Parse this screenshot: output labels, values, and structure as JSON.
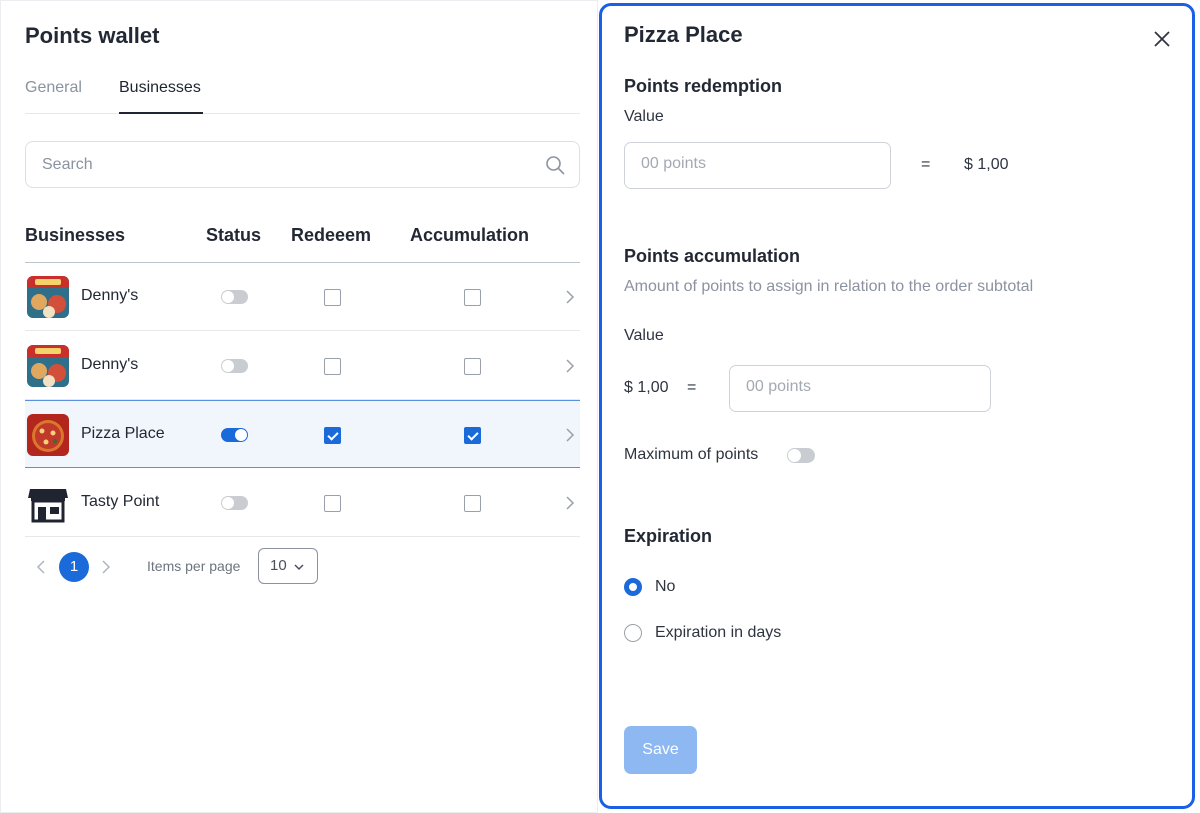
{
  "wallet": {
    "title": "Points wallet",
    "tabs": [
      {
        "label": "General"
      },
      {
        "label": "Businesses"
      }
    ],
    "search": {
      "placeholder": "Search"
    },
    "columns": {
      "business": "Businesses",
      "status": "Status",
      "redeem": "Redeeem",
      "accumulation": "Accumulation"
    },
    "rows": [
      {
        "name": "Denny's",
        "status": false,
        "redeem": false,
        "accumulation": false,
        "thumb": "dennys"
      },
      {
        "name": "Denny's",
        "status": false,
        "redeem": false,
        "accumulation": false,
        "thumb": "dennys"
      },
      {
        "name": "Pizza Place",
        "status": true,
        "redeem": true,
        "accumulation": true,
        "thumb": "pizza",
        "selected": true
      },
      {
        "name": "Tasty Point",
        "status": false,
        "redeem": false,
        "accumulation": false,
        "thumb": "store"
      }
    ],
    "pagination": {
      "current_page": "1",
      "items_per_page_label": "Items per page",
      "items_per_page": "10"
    }
  },
  "panel": {
    "title": "Pizza Place",
    "redemption": {
      "heading": "Points redemption",
      "value_label": "Value",
      "input_placeholder": "00 points",
      "equals": "=",
      "amount": "$ 1,00"
    },
    "accumulation": {
      "heading": "Points accumulation",
      "description": "Amount of points to assign in relation to the order subtotal",
      "value_label": "Value",
      "amount": "$ 1,00",
      "equals": "=",
      "input_placeholder": "00 points",
      "max_points_label": "Maximum of points",
      "max_points_enabled": false
    },
    "expiration": {
      "heading": "Expiration",
      "options": [
        {
          "label": "No",
          "selected": true
        },
        {
          "label": "Expiration in days",
          "selected": false
        }
      ]
    },
    "save_label": "Save"
  },
  "colors": {
    "accent": "#1a6ad9",
    "panel_border": "#1a5fe6",
    "save_disabled": "#8db8f2"
  }
}
